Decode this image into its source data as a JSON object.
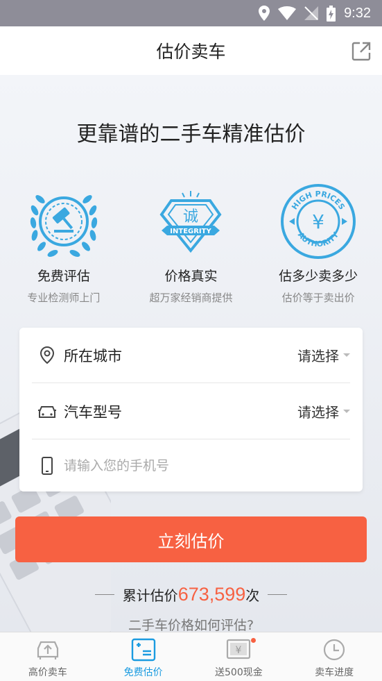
{
  "status_bar": {
    "time": "9:32",
    "icons": [
      "location-icon",
      "wifi-icon",
      "no-sim-icon",
      "battery-charging-icon"
    ]
  },
  "header": {
    "title": "估价卖车",
    "share_icon": "share-icon"
  },
  "headline": "更靠谱的二手车精准估价",
  "features": [
    {
      "title": "免费评估",
      "subtitle": "专业检测师上门",
      "icon": "gavel-laurel-badge-icon"
    },
    {
      "title": "价格真实",
      "subtitle": "超万家经销商提供",
      "icon": "integrity-diamond-badge-icon",
      "badge_text": "诚",
      "badge_ribbon": "INTEGRITY"
    },
    {
      "title": "估多少卖多少",
      "subtitle": "估价等于卖出价",
      "icon": "yuan-seal-badge-icon",
      "badge_top": "HIGH PRICES",
      "badge_bottom": "AUTHORITY",
      "badge_center": "¥"
    }
  ],
  "form": {
    "city": {
      "label": "所在城市",
      "value": "请选择",
      "icon": "location-pin-icon"
    },
    "model": {
      "label": "汽车型号",
      "value": "请选择",
      "icon": "car-icon"
    },
    "phone": {
      "placeholder": "请输入您的手机号",
      "value": "",
      "icon": "phone-icon"
    }
  },
  "submit_label": "立刻估价",
  "counter": {
    "prefix": "累计估价",
    "number": "673,599",
    "suffix": "次"
  },
  "howto": "二手车价格如何评估?",
  "tabs": [
    {
      "label": "高价卖车",
      "icon": "car-upload-icon",
      "active": false
    },
    {
      "label": "免费估价",
      "icon": "estimate-card-icon",
      "active": true
    },
    {
      "label": "送500现金",
      "icon": "cash-envelope-icon",
      "active": false,
      "notification": true
    },
    {
      "label": "卖车进度",
      "icon": "clock-icon",
      "active": false
    }
  ],
  "colors": {
    "accent": "#f76142",
    "tab_active": "#1a9be0",
    "badge_blue": "#3aa8e0",
    "status_bar": "#8e8d98"
  }
}
